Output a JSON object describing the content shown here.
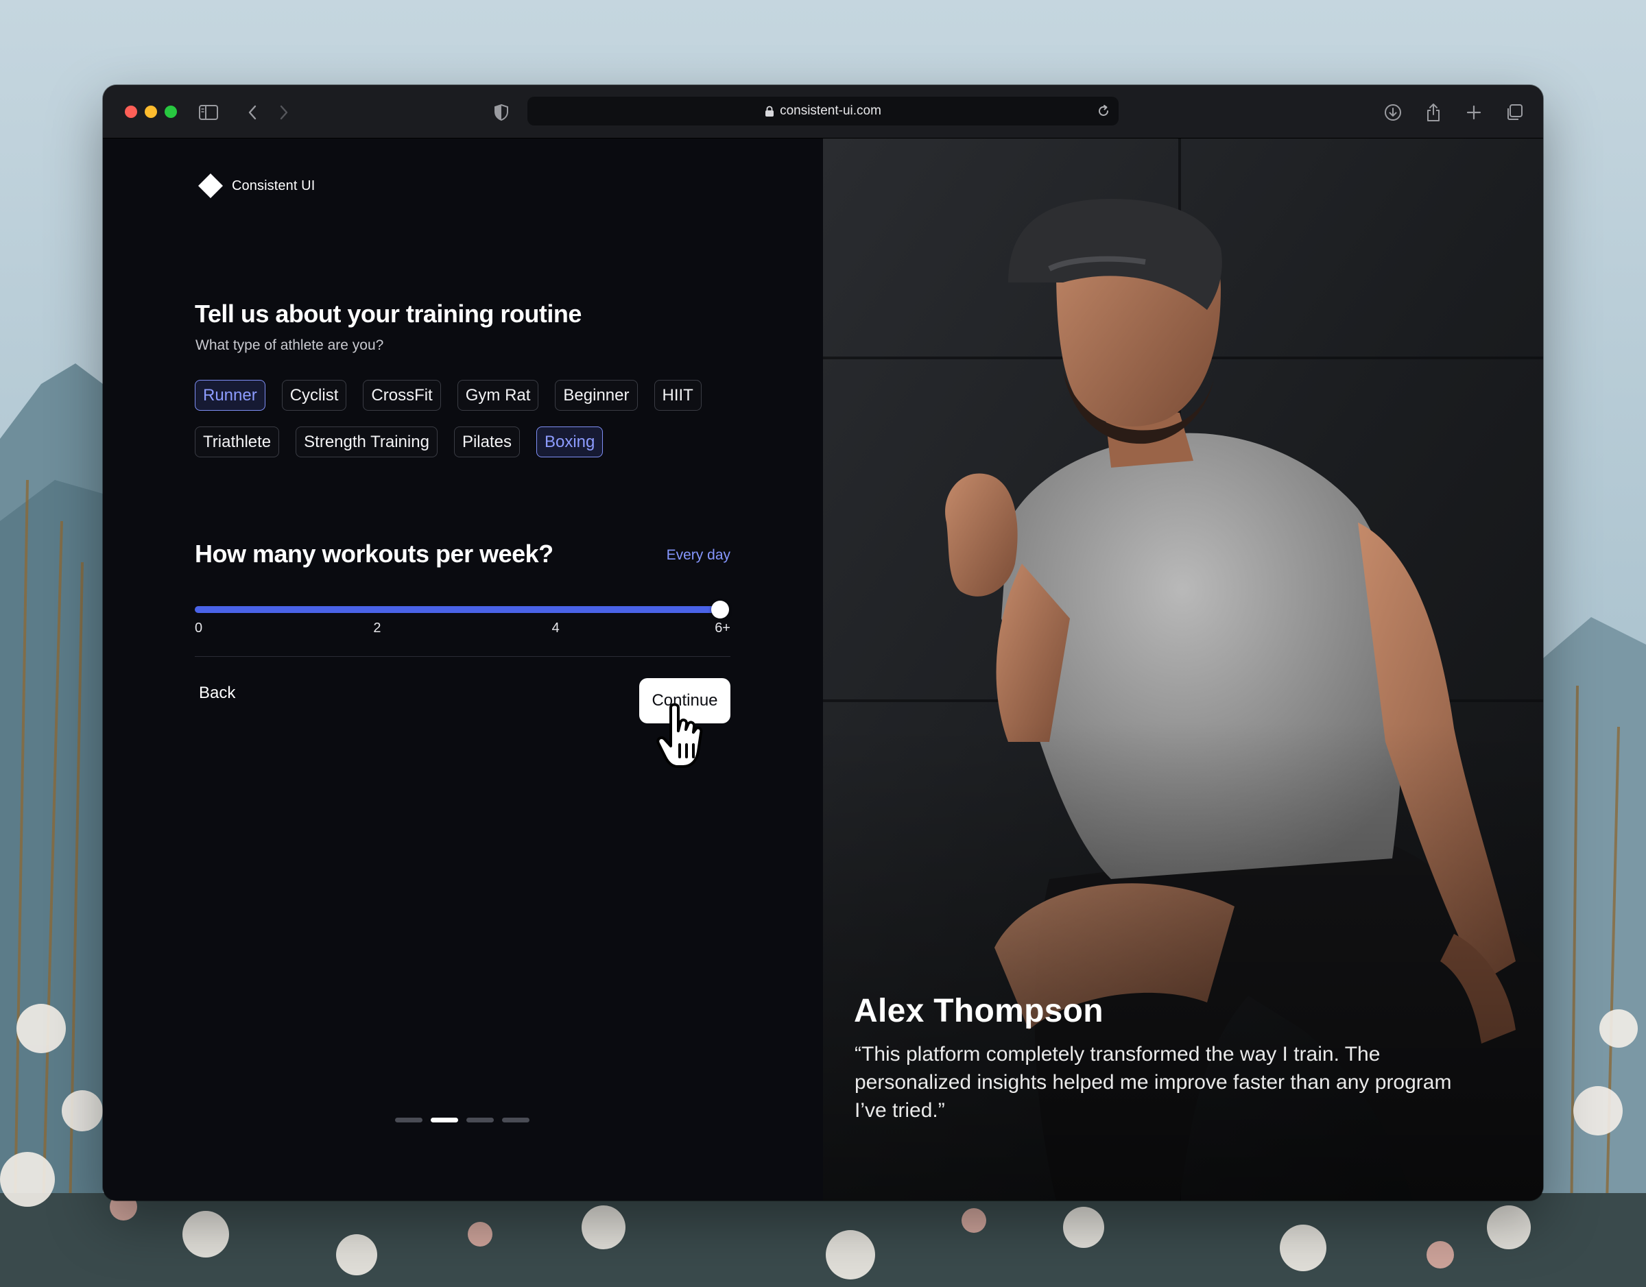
{
  "browser": {
    "url": "consistent-ui.com"
  },
  "brand": {
    "name": "Consistent UI"
  },
  "onboarding": {
    "title": "Tell us about your training routine",
    "subtitle": "What type of athlete are you?",
    "athlete_types": [
      {
        "label": "Runner",
        "selected": true
      },
      {
        "label": "Cyclist",
        "selected": false
      },
      {
        "label": "CrossFit",
        "selected": false
      },
      {
        "label": "Gym Rat",
        "selected": false
      },
      {
        "label": "Beginner",
        "selected": false
      },
      {
        "label": "HIIT",
        "selected": false
      },
      {
        "label": "Triathlete",
        "selected": false
      },
      {
        "label": "Strength Training",
        "selected": false
      },
      {
        "label": "Pilates",
        "selected": false
      },
      {
        "label": "Boxing",
        "selected": true
      }
    ],
    "workouts": {
      "question": "How many workouts per week?",
      "value_label": "Every day",
      "value_fraction": 1.0,
      "ticks": [
        "0",
        "2",
        "4",
        "6+"
      ]
    },
    "back_label": "Back",
    "continue_label": "Continue",
    "steps": {
      "total": 4,
      "current": 2
    }
  },
  "testimonial": {
    "name": "Alex Thompson",
    "quote": "“This platform completely transformed the way I train. The personalized insights helped me improve faster than any program I’ve tried.”"
  },
  "colors": {
    "accent": "#4a63e8",
    "accent_text": "#8697ff",
    "panel_bg": "#0a0b10"
  }
}
